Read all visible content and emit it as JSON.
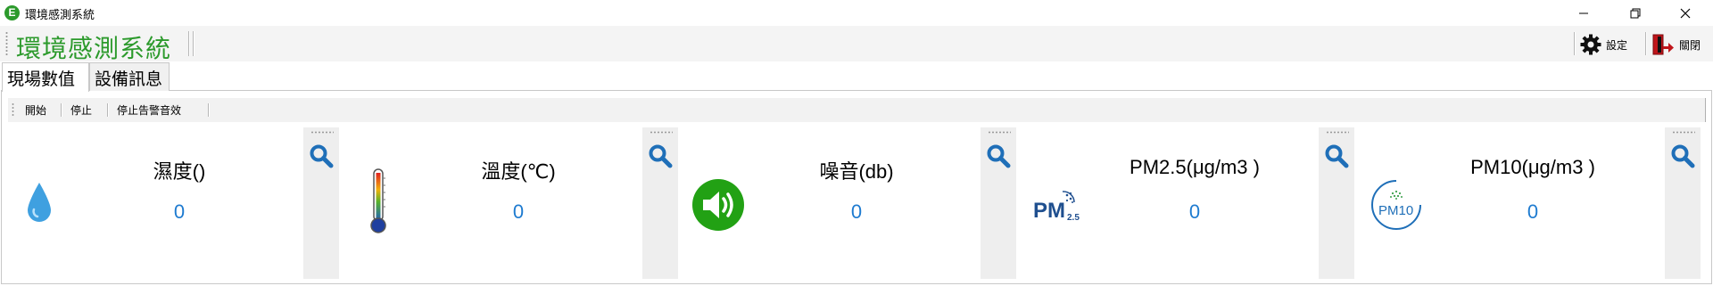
{
  "window": {
    "title": "環境感測系統",
    "app_icon_letter": "E",
    "controls": [
      "minimize",
      "restore",
      "close"
    ]
  },
  "toolbar": {
    "app_title": "環境感測系統",
    "settings_label": "設定",
    "close_label": "關閉",
    "icons": {
      "settings": "gear-icon",
      "close": "exit-door-icon"
    }
  },
  "tabs": [
    {
      "label": "現場數值",
      "active": true
    },
    {
      "label": "設備訊息",
      "active": false
    }
  ],
  "controls": {
    "start": "開始",
    "stop": "停止",
    "stop_alarm": "停止告警音效"
  },
  "cards": [
    {
      "label": "濕度()",
      "value": "0",
      "icon": "water-drop-icon"
    },
    {
      "label": "溫度(℃)",
      "value": "0",
      "icon": "thermometer-icon"
    },
    {
      "label": "噪音(db)",
      "value": "0",
      "icon": "speaker-icon"
    },
    {
      "label": "PM2.5(μg/m3 )",
      "value": "0",
      "icon": "pm25-icon"
    },
    {
      "label": "PM10(μg/m3 )",
      "value": "0",
      "icon": "pm10-icon"
    }
  ],
  "pm_icon_text": {
    "pm": "PM",
    "sub25": "2.5",
    "pm10": "PM10"
  },
  "colors": {
    "accent_green": "#2c9a2c",
    "value_blue": "#1e7bd0",
    "search_blue": "#1f6fb8",
    "speaker_green": "#22a114"
  }
}
